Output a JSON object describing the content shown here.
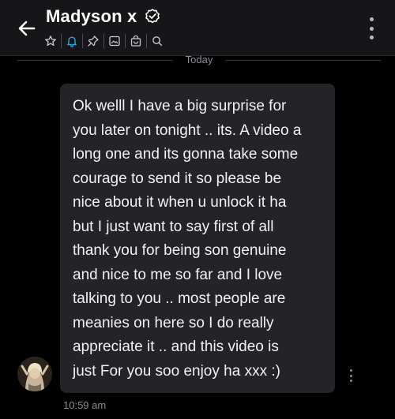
{
  "header": {
    "title": "Madyson x",
    "icons": [
      "back-arrow-icon",
      "verified-check-icon",
      "star-icon",
      "bell-icon",
      "pin-icon",
      "image-icon",
      "shopping-bag-icon",
      "search-icon",
      "more-vertical-icon"
    ],
    "accent_color": "#2aa7e0"
  },
  "conversation": {
    "day_separator": "Today",
    "message": {
      "text": "Ok welll I have a big surprise for\nyou later on tonight .. its. A video a\nlong one and its gonna take some\ncourage to send it so please be\nnice about it when u unlock it ha\nbut I just want to say first of all\nthank you for being son genuine\nand nice to me so far and I love\ntalking to you .. most people are\nmeanies on here so I do really\nappreciate it .. and this video is\njust For you soo enjoy ha xxx :)",
      "timestamp": "10:59 am"
    }
  }
}
